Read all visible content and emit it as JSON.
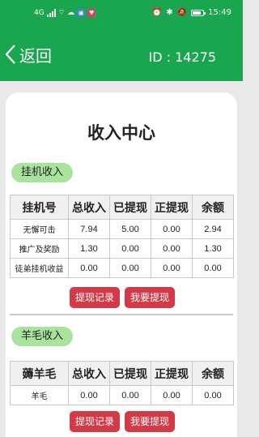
{
  "status_bar": {
    "left_text": "4G",
    "time": "15:49"
  },
  "header": {
    "back_label": "返回",
    "user_id": "ID : 14275",
    "bg_color": "#1aa54f"
  },
  "page_title": "收入中心",
  "sections": [
    {
      "title": "挂机收入",
      "columns": [
        "挂机号",
        "总收入",
        "已提现",
        "正提现",
        "余额"
      ],
      "rows": [
        [
          "无懈可击",
          "7.94",
          "5.00",
          "0.00",
          "2.94"
        ],
        [
          "推广及奖励",
          "1.30",
          "0.00",
          "0.00",
          "1.30"
        ],
        [
          "徒弟挂机收益",
          "0.00",
          "0.00",
          "0.00",
          "0.00"
        ]
      ],
      "buttons": {
        "history": "提现记录",
        "withdraw": "我要提现"
      }
    },
    {
      "title": "羊毛收入",
      "columns": [
        "薅羊毛",
        "总收入",
        "已提现",
        "正提现",
        "余额"
      ],
      "rows": [
        [
          "羊毛",
          "0.00",
          "0.00",
          "0.00",
          "0.00"
        ]
      ],
      "buttons": {
        "history": "提现记录",
        "withdraw": "我要提现"
      }
    }
  ],
  "colors": {
    "pill": "#a9e49f",
    "button": "#d33a48"
  }
}
